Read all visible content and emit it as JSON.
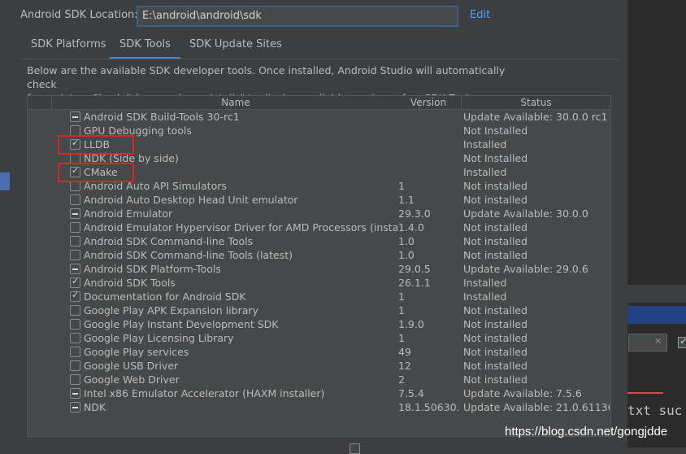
{
  "sdk_location": {
    "label": "Android SDK Location:",
    "value": "E:\\android\\android\\sdk",
    "edit_label": "Edit"
  },
  "tabs": [
    {
      "label": "SDK Platforms"
    },
    {
      "label": "SDK Tools",
      "selected": true
    },
    {
      "label": "SDK Update Sites"
    }
  ],
  "description": {
    "line1": "Below are the available SDK developer tools. Once installed, Android Studio will automatically check",
    "line2": "for updates. Check \"show package details\" to display available versions of an SDK Tool."
  },
  "table": {
    "headers": {
      "name": "Name",
      "version": "Version",
      "status": "Status"
    },
    "rows": [
      {
        "state": "partial",
        "name": "Android SDK Build-Tools 30-rc1",
        "version": "",
        "status": "Update Available: 30.0.0 rc1"
      },
      {
        "state": "unchecked",
        "name": "GPU Debugging tools",
        "version": "",
        "status": "Not Installed"
      },
      {
        "state": "checked",
        "name": "LLDB",
        "version": "",
        "status": "Installed"
      },
      {
        "state": "unchecked",
        "name": "NDK (Side by side)",
        "version": "",
        "status": "Not Installed"
      },
      {
        "state": "checked",
        "name": "CMake",
        "version": "",
        "status": "Installed"
      },
      {
        "state": "unchecked",
        "name": "Android Auto API Simulators",
        "version": "1",
        "status": "Not installed"
      },
      {
        "state": "unchecked",
        "name": "Android Auto Desktop Head Unit emulator",
        "version": "1.1",
        "status": "Not installed"
      },
      {
        "state": "partial",
        "name": "Android Emulator",
        "version": "29.3.0",
        "status": "Update Available: 30.0.0"
      },
      {
        "state": "unchecked",
        "name": "Android Emulator Hypervisor Driver for AMD Processors (installer)",
        "version": "1.4.0",
        "status": "Not installed"
      },
      {
        "state": "unchecked",
        "name": "Android SDK Command-line Tools",
        "version": "1.0",
        "status": "Not installed"
      },
      {
        "state": "unchecked",
        "name": "Android SDK Command-line Tools (latest)",
        "version": "1.0",
        "status": "Not installed"
      },
      {
        "state": "partial",
        "name": "Android SDK Platform-Tools",
        "version": "29.0.5",
        "status": "Update Available: 29.0.6"
      },
      {
        "state": "checked",
        "name": "Android SDK Tools",
        "version": "26.1.1",
        "status": "Installed"
      },
      {
        "state": "checked",
        "name": "Documentation for Android SDK",
        "version": "1",
        "status": "Installed"
      },
      {
        "state": "unchecked",
        "name": "Google Play APK Expansion library",
        "version": "1",
        "status": "Not installed"
      },
      {
        "state": "unchecked",
        "name": "Google Play Instant Development SDK",
        "version": "1.9.0",
        "status": "Not installed"
      },
      {
        "state": "unchecked",
        "name": "Google Play Licensing Library",
        "version": "1",
        "status": "Not installed"
      },
      {
        "state": "unchecked",
        "name": "Google Play services",
        "version": "49",
        "status": "Not installed"
      },
      {
        "state": "unchecked",
        "name": "Google USB Driver",
        "version": "12",
        "status": "Not installed"
      },
      {
        "state": "unchecked",
        "name": "Google Web Driver",
        "version": "2",
        "status": "Not installed"
      },
      {
        "state": "partial",
        "name": "Intel x86 Emulator Accelerator (HAXM installer)",
        "version": "7.5.4",
        "status": "Update Available: 7.5.6"
      },
      {
        "state": "partial",
        "name": "NDK",
        "version": "18.1.50630...",
        "status": "Update Available: 21.0.61136..."
      }
    ]
  },
  "background": {
    "code_text": "txt suc"
  },
  "watermark": "https://blog.csdn.net/gongjdde",
  "colors": {
    "accent": "#4a88c7",
    "link": "#589df6",
    "highlight": "#e02424"
  }
}
